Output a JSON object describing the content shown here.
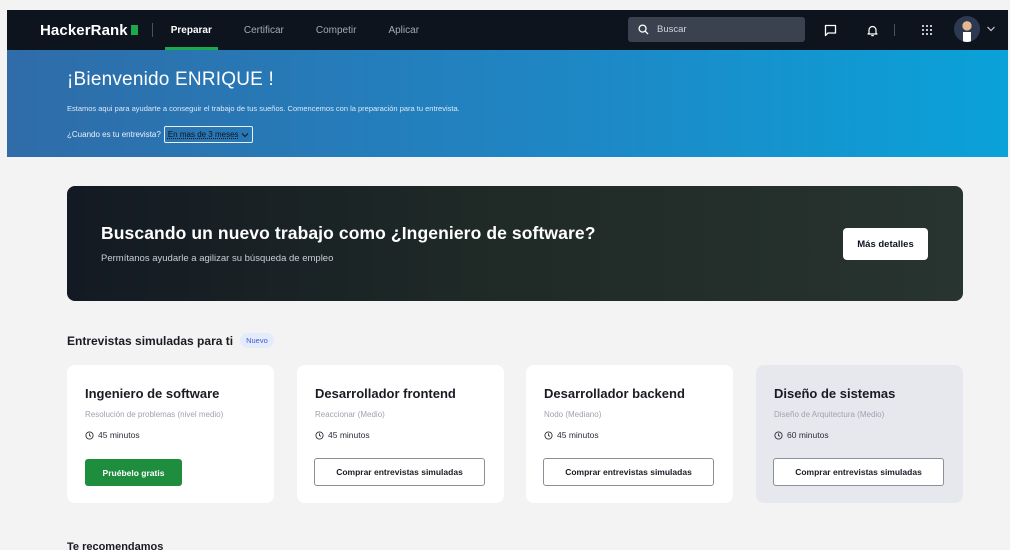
{
  "nav": {
    "logo": "HackerRank",
    "items": [
      {
        "label": "Preparar",
        "active": true
      },
      {
        "label": "Certificar",
        "active": false
      },
      {
        "label": "Competir",
        "active": false
      },
      {
        "label": "Aplicar",
        "active": false
      }
    ],
    "search_placeholder": "Buscar",
    "icons": [
      "search-icon",
      "chat-icon",
      "bell-icon",
      "grid-icon",
      "avatar",
      "chevron-down-icon"
    ]
  },
  "banner": {
    "welcome": "¡Bienvenido ENRIQUE !",
    "subtitle": "Estamos aqui para ayudarte a conseguir el trabajo de tus sueños. Comencemos con la preparación para tu entrevista.",
    "interview_question": "¿Cuando es tu entrevista?",
    "interview_value": "En mas de 3 meses"
  },
  "hero": {
    "title": "Buscando un nuevo trabajo como ¿Ingeniero de software?",
    "subtitle": "Permítanos ayudarle a agilizar su búsqueda de empleo",
    "button": "Más detalles"
  },
  "mock": {
    "title": "Entrevistas simuladas para ti",
    "badge": "Nuevo",
    "cards": [
      {
        "title": "Ingeniero de software",
        "subtitle": "Resolución de problemas (nivel medio)",
        "time": "45 minutos",
        "button": "Pruébelo gratis",
        "style": "primary"
      },
      {
        "title": "Desarrollador frontend",
        "subtitle": "Reaccionar (Medio)",
        "time": "45 minutos",
        "button": "Comprar entrevistas simuladas",
        "style": "outline"
      },
      {
        "title": "Desarrollador backend",
        "subtitle": "Nodo (Mediano)",
        "time": "45 minutos",
        "button": "Comprar entrevistas simuladas",
        "style": "outline"
      },
      {
        "title": "Diseño de sistemas",
        "subtitle": "Diseño de Arquitectura (Medio)",
        "time": "60 minutos",
        "button": "Comprar entrevistas simuladas",
        "style": "outline"
      }
    ]
  },
  "recommend": {
    "title": "Te recomendamos"
  },
  "colors": {
    "nav_bg": "#0e141e",
    "accent_green": "#1ba94c",
    "button_green": "#1e8e3e",
    "banner_blue": "#1f86c4"
  }
}
